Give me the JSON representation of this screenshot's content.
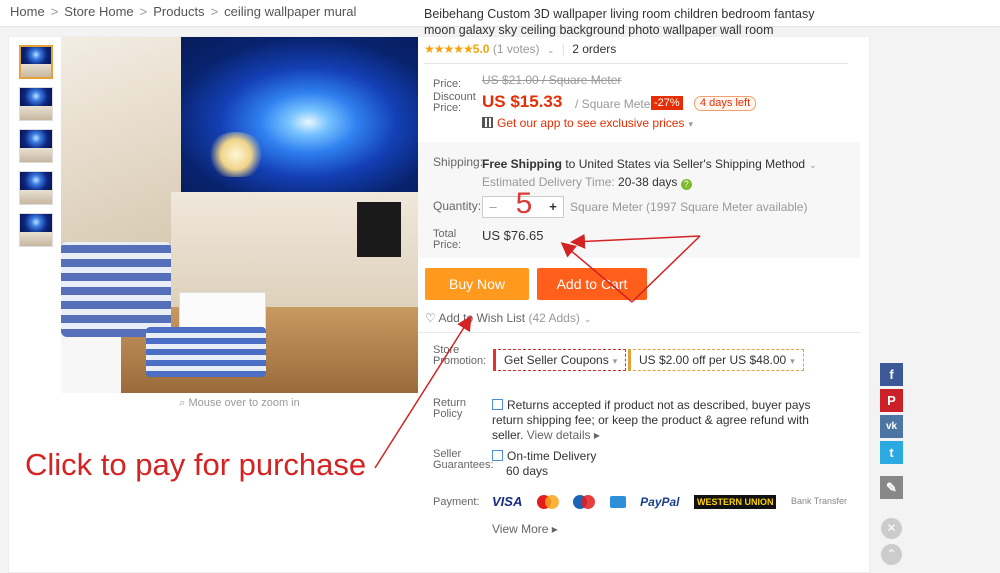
{
  "breadcrumb": {
    "items": [
      "Home",
      "Store Home",
      "Products",
      "ceiling wallpaper mural"
    ],
    "separator": ">"
  },
  "gallery": {
    "thumbnail_count": 5,
    "zoom_hint": "Mouse over to zoom in"
  },
  "product": {
    "title": "Beibehang Custom 3D wallpaper living room children bedroom fantasy moon galaxy sky ceiling background photo wallpaper wall room",
    "stars": "★★★★★",
    "score": "5.0",
    "votes": "(1 votes)",
    "orders": "2 orders"
  },
  "pricing": {
    "price_label": "Price:",
    "original_price": "US $21.00 / Square Meter",
    "discount_label_1": "Discount",
    "discount_label_2": "Price:",
    "discount_price": "US $15.33",
    "unit": "/ Square Meter",
    "discount_badge": "-27%",
    "days_left": "4 days left",
    "app_promo": "Get our app to see exclusive prices"
  },
  "shipping": {
    "label": "Shipping:",
    "method_bold": "Free Shipping",
    "method_rest": " to United States via Seller's Shipping Method",
    "estimated_label": "Estimated Delivery Time: ",
    "estimated_value": "20-38 days"
  },
  "quantity": {
    "label": "Quantity:",
    "minus": "–",
    "plus": "+",
    "value": "5",
    "availability": "Square Meter (1997 Square Meter available)"
  },
  "total": {
    "label_1": "Total",
    "label_2": "Price:",
    "value": "US $76.65"
  },
  "actions": {
    "buy_now": "Buy Now",
    "add_to_cart": "Add to Cart",
    "wish_list": "Add to Wish List",
    "wish_count": "(42 Adds)"
  },
  "promotion": {
    "label_1": "Store",
    "label_2": "Promotion:",
    "coupon": "Get Seller Coupons",
    "deal": "US $2.00 off per US $48.00"
  },
  "return_policy": {
    "label_1": "Return",
    "label_2": "Policy",
    "text": "Returns accepted if product not as described, buyer pays return shipping fee; or keep the product & agree refund with seller.",
    "details": "View details"
  },
  "guarantee": {
    "label_1": "Seller",
    "label_2": "Guarantees:",
    "title": "On-time Delivery",
    "days": "60 days"
  },
  "payment": {
    "label": "Payment:",
    "methods": [
      "VISA",
      "PayPal",
      "WESTERN UNION",
      "Bank Transfer"
    ],
    "view_more": "View More"
  },
  "annotation": {
    "text": "Click to pay for purchase",
    "color": "#d32323"
  },
  "colors": {
    "price_red": "#e62e04",
    "buy_now": "#ff9a1e",
    "add_to_cart": "#ff5f1a"
  },
  "social": [
    "facebook-icon",
    "pinterest-icon",
    "vk-icon",
    "twitter-icon"
  ]
}
